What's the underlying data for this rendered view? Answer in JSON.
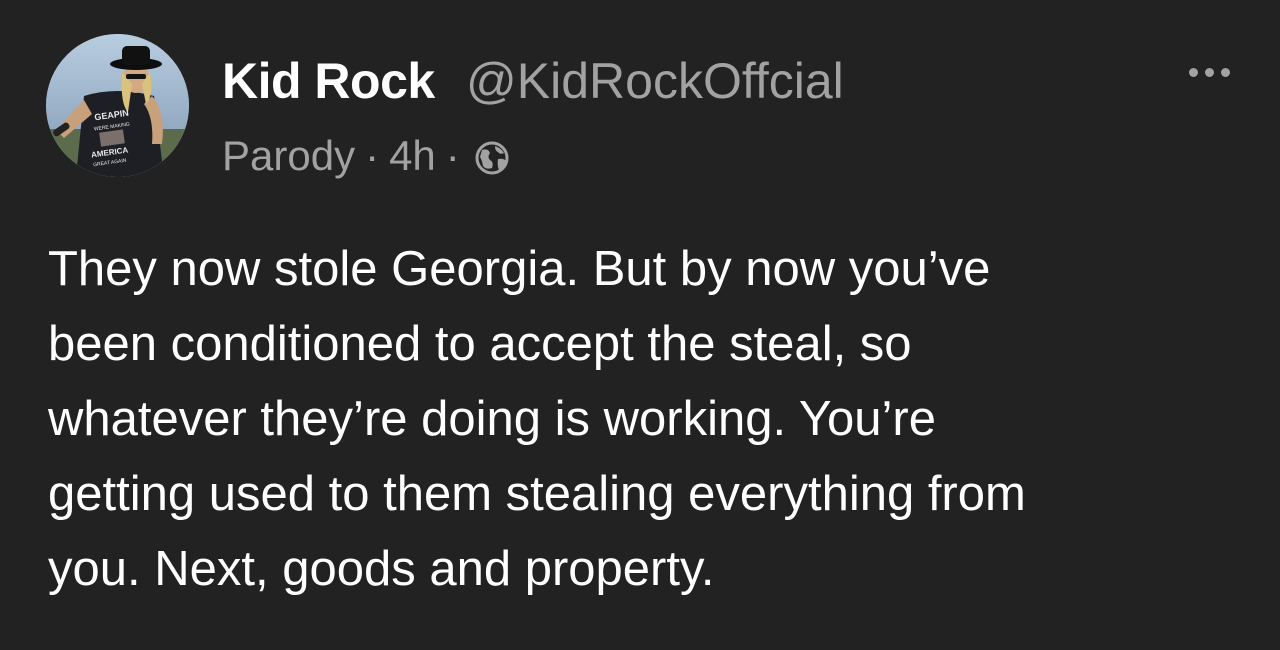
{
  "author": {
    "display_name": "Kid Rock",
    "handle": "@KidRockOffcial",
    "avatar_shirt_text": "GEAPIN WERE MAKING AMERICA GREAT AGAIN"
  },
  "meta": {
    "label": "Parody",
    "separator": "·",
    "time": "4h",
    "visibility_icon": "globe-icon"
  },
  "menu": {
    "icon": "more-horizontal-icon"
  },
  "post": {
    "lines": [
      "They now stole Georgia. But by now you’ve",
      "been conditioned to accept the steal, so",
      "whatever they’re doing is working. You’re",
      "getting used to them stealing everything from",
      "you. Next, goods and property."
    ]
  },
  "colors": {
    "background": "#222222",
    "primary_text": "#ffffff",
    "secondary_text": "#a2a2a2"
  }
}
